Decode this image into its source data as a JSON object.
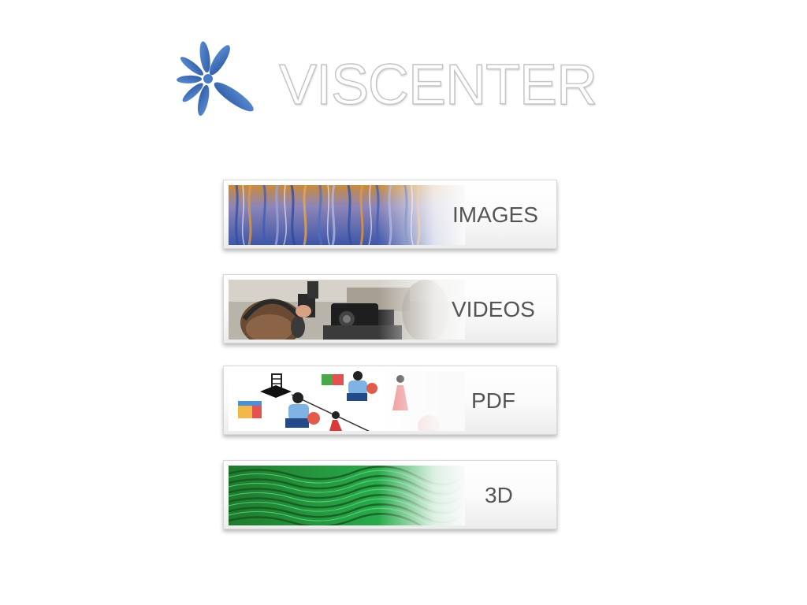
{
  "logo": {
    "text": "VISCENTER",
    "icon": "starburst-logo-icon",
    "mark_color": "#3f6fb7"
  },
  "menu": {
    "items": [
      {
        "id": "images",
        "label": "IMAGES",
        "thumbnail": "abstract-blue-orange-texture"
      },
      {
        "id": "videos",
        "label": "VIDEOS",
        "thumbnail": "camera-crew-photo"
      },
      {
        "id": "pdf",
        "label": "PDF",
        "thumbnail": "children-playing-illustration"
      },
      {
        "id": "3d",
        "label": "3D",
        "thumbnail": "green-ripple-surface"
      }
    ]
  }
}
